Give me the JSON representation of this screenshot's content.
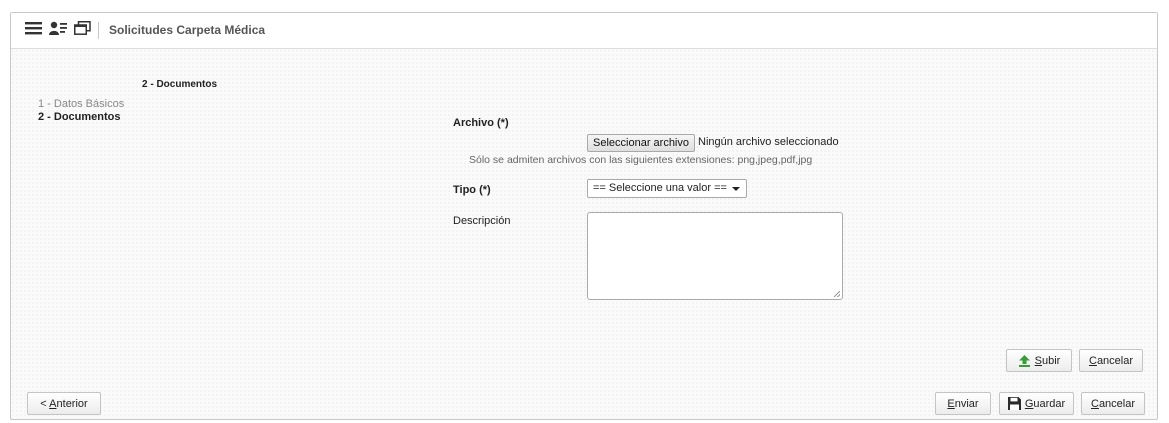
{
  "header": {
    "title": "Solicitudes Carpeta Médica",
    "icons": [
      "menu-icon",
      "users-icon",
      "window-icon"
    ]
  },
  "steps": {
    "current_title": "2 - Documentos",
    "items": [
      {
        "label": "1 - Datos Básicos"
      },
      {
        "label": "2 - Documentos"
      }
    ]
  },
  "form": {
    "archivo_label": "Archivo (*)",
    "file_button": "Seleccionar archivo",
    "file_status": "Ningún archivo seleccionado",
    "file_hint": "Sólo se admiten archivos con las siguientes extensiones: png,jpeg,pdf,jpg",
    "tipo_label": "Tipo (*)",
    "tipo_value": "== Seleccione una valor ==",
    "descripcion_label": "Descripción",
    "descripcion_value": ""
  },
  "upload_actions": {
    "subir_first": "S",
    "subir_rest": "ubir",
    "cancelar_first": "C",
    "cancelar_rest": "ancelar"
  },
  "footer": {
    "anterior_prefix": "< ",
    "anterior_first": "A",
    "anterior_rest": "nterior",
    "enviar_first": "E",
    "enviar_rest": "nviar",
    "guardar_first": "G",
    "guardar_rest": "uardar",
    "cancelar_first": "C",
    "cancelar_rest": "ancelar"
  },
  "colors": {
    "upload_icon": "#3a9b3a",
    "save_icon": "#2b2b2b"
  }
}
